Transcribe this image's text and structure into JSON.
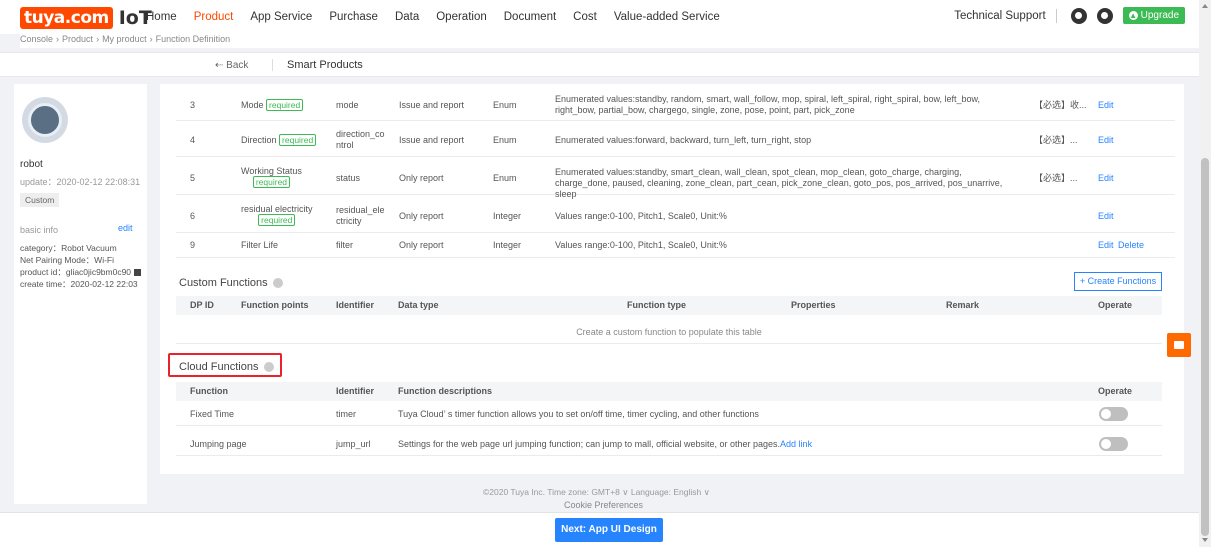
{
  "nav": {
    "logo_text": "tuya.com",
    "logo_suffix": "IoT",
    "items": [
      "Home",
      "Product",
      "App Service",
      "Purchase",
      "Data",
      "Operation",
      "Document",
      "Cost",
      "Value-added Service"
    ],
    "active": "Product",
    "technical_support": "Technical Support",
    "upgrade": "Upgrade"
  },
  "breadcrumb": [
    "Console",
    "Product",
    "My product",
    "Function Definition"
  ],
  "subheader": {
    "back": "Back",
    "title": "Smart Products"
  },
  "product": {
    "name": "robot",
    "update": "update：2020-02-12 22:08:31",
    "custom": "Custom",
    "basic_info": "basic info",
    "edit": "edit",
    "category": "category：Robot Vacuum",
    "pairing": "Net Pairing Mode：Wi-Fi",
    "product_id": "product id：gliac0jic9bm0c90",
    "create_time": "create time：2020-02-12 22:03"
  },
  "standard_rows": [
    {
      "id": "3",
      "name": "Mode",
      "required": "required",
      "identifier": "mode",
      "data_transfer": "Issue and report",
      "type": "Enum",
      "props": "Enumerated values:standby, random, smart, wall_follow, mop, spiral, left_spiral, right_spiral, bow, left_bow, right_bow, partial_bow, chargego, single, zone, pose, point, part, pick_zone",
      "remark": "【必选】收...",
      "edit": "Edit",
      "delete": ""
    },
    {
      "id": "4",
      "name": "Direction",
      "required": "required",
      "identifier": "direction_control",
      "data_transfer": "Issue and report",
      "type": "Enum",
      "props": "Enumerated values:forward, backward, turn_left, turn_right, stop",
      "remark": "【必选】...",
      "edit": "Edit",
      "delete": ""
    },
    {
      "id": "5",
      "name": "Working Status",
      "required": "required",
      "identifier": "status",
      "data_transfer": "Only report",
      "type": "Enum",
      "props": "Enumerated values:standby, smart_clean, wall_clean, spot_clean, mop_clean, goto_charge, charging, charge_done, paused, cleaning, zone_clean, part_cean, pick_zone_clean, goto_pos, pos_arrived, pos_unarrive, sleep",
      "remark": "【必选】...",
      "edit": "Edit",
      "delete": ""
    },
    {
      "id": "6",
      "name": "residual electricity",
      "required": "required",
      "identifier": "residual_electricity",
      "data_transfer": "Only report",
      "type": "Integer",
      "props": "Values range:0-100, Pitch1, Scale0, Unit:%",
      "remark": "",
      "edit": "Edit",
      "delete": ""
    },
    {
      "id": "9",
      "name": "Filter Life",
      "required": "",
      "identifier": "filter",
      "data_transfer": "Only report",
      "type": "Integer",
      "props": "Values range:0-100, Pitch1, Scale0, Unit:%",
      "remark": "",
      "edit": "Edit",
      "delete": "Delete"
    }
  ],
  "custom_functions": {
    "title": "Custom Functions",
    "create_button": "+ Create Functions",
    "headers": [
      "DP ID",
      "Function points",
      "Identifier",
      "Data type",
      "Function type",
      "Properties",
      "Remark",
      "Operate"
    ],
    "empty": "Create a custom function to populate this table"
  },
  "cloud_functions": {
    "title": "Cloud Functions",
    "headers": [
      "Function",
      "Identifier",
      "Function descriptions",
      "Operate"
    ],
    "rows": [
      {
        "function": "Fixed Time",
        "identifier": "timer",
        "description": "Tuya Cloud’ s timer function allows you to set on/off time, timer cycling, and other functions",
        "link": "",
        "enabled": false
      },
      {
        "function": "Jumping page",
        "identifier": "jump_url",
        "description": "Settings for the web page url jumping function; can jump to mall, official website, or other pages.",
        "link": "Add link",
        "enabled": false
      }
    ]
  },
  "footer": {
    "line1": "©2020 Tuya Inc.   Time zone:  GMT+8  ∨   Language:  English  ∨",
    "line2": "Cookie Preferences"
  },
  "next_button": "Next: App UI Design",
  "colors": {
    "brand": "#ff4800",
    "link": "#2684ff",
    "required": "#3cba54",
    "highlight": "#e8232a"
  }
}
